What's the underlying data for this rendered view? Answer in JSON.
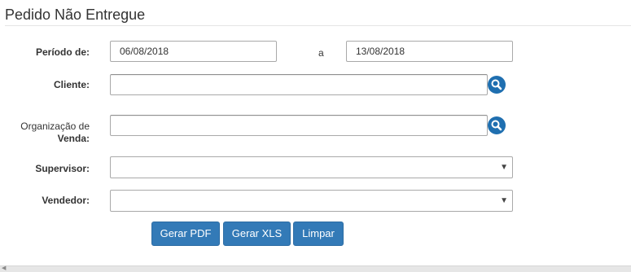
{
  "page": {
    "title": "Pedido Não Entregue"
  },
  "form": {
    "periodo_label": "Período de:",
    "periodo_de_value": "06/08/2018",
    "periodo_sep": "a",
    "periodo_ate_value": "13/08/2018",
    "cliente_label": "Cliente:",
    "cliente_value": "",
    "organizacao_label_line1": "Organização de",
    "organizacao_label_line2": "Venda:",
    "organizacao_value": "",
    "supervisor_label": "Supervisor:",
    "supervisor_value": "",
    "vendedor_label": "Vendedor:",
    "vendedor_value": ""
  },
  "icons": {
    "lookup": "search-icon",
    "dropdown": "chevron-down-icon",
    "scroll_left": "arrow-left-icon"
  },
  "buttons": {
    "pdf_label": "Gerar PDF",
    "xls_label": "Gerar XLS",
    "limpar_label": "Limpar"
  },
  "colors": {
    "primary_button": "#337ab7",
    "lookup_icon": "#1f6fb0"
  }
}
